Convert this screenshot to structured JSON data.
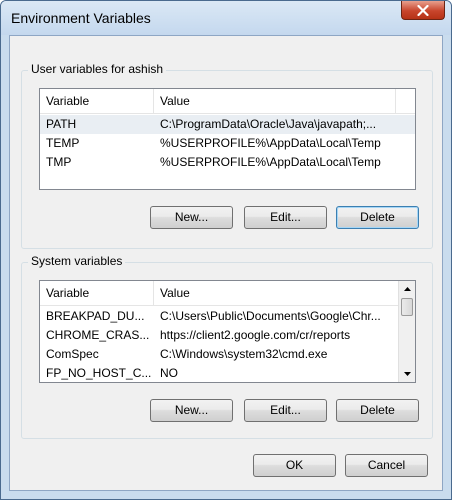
{
  "window": {
    "title": "Environment Variables"
  },
  "user_vars": {
    "group_label": "User variables for ashish",
    "columns": [
      "Variable",
      "Value"
    ],
    "rows": [
      {
        "variable": "PATH",
        "value": "C:\\ProgramData\\Oracle\\Java\\javapath;...",
        "selected": true
      },
      {
        "variable": "TEMP",
        "value": "%USERPROFILE%\\AppData\\Local\\Temp"
      },
      {
        "variable": "TMP",
        "value": "%USERPROFILE%\\AppData\\Local\\Temp"
      }
    ],
    "buttons": {
      "new": "New...",
      "edit": "Edit...",
      "delete": "Delete"
    }
  },
  "system_vars": {
    "group_label": "System variables",
    "columns": [
      "Variable",
      "Value"
    ],
    "rows": [
      {
        "variable": "BREAKPAD_DU...",
        "value": "C:\\Users\\Public\\Documents\\Google\\Chr..."
      },
      {
        "variable": "CHROME_CRAS...",
        "value": "https://client2.google.com/cr/reports"
      },
      {
        "variable": "ComSpec",
        "value": "C:\\Windows\\system32\\cmd.exe"
      },
      {
        "variable": "FP_NO_HOST_C...",
        "value": "NO"
      }
    ],
    "buttons": {
      "new": "New...",
      "edit": "Edit...",
      "delete": "Delete"
    }
  },
  "dialog_buttons": {
    "ok": "OK",
    "cancel": "Cancel"
  }
}
